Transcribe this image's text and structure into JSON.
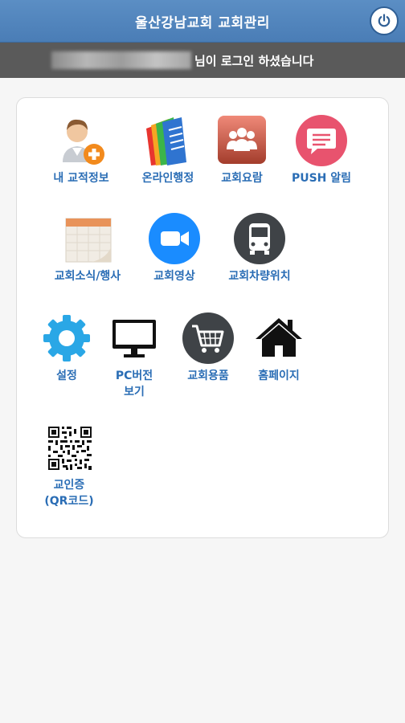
{
  "header": {
    "title": "울산강남교회 교회관리",
    "power_icon": "power-icon"
  },
  "login": {
    "suffix": "님이 로그인 하셨습니다"
  },
  "menu": {
    "items": [
      {
        "label": "내 교적정보",
        "icon": "add-user-icon"
      },
      {
        "label": "온라인행정",
        "icon": "documents-icon"
      },
      {
        "label": "교회요람",
        "icon": "people-group-icon"
      },
      {
        "label": "PUSH 알림",
        "icon": "message-icon"
      },
      {
        "label": "교회소식/행사",
        "icon": "calendar-icon"
      },
      {
        "label": "교회영상",
        "icon": "video-camera-icon"
      },
      {
        "label": "교회차량위치",
        "icon": "bus-icon"
      },
      {
        "label": "설정",
        "icon": "gear-icon"
      },
      {
        "label": "PC버전",
        "label2": "보기",
        "icon": "monitor-icon"
      },
      {
        "label": "교회용품",
        "icon": "shopping-cart-icon"
      },
      {
        "label": "홈페이지",
        "icon": "home-icon"
      },
      {
        "label": "교인증",
        "label2": "(QR코드)",
        "icon": "qr-code-icon"
      }
    ]
  },
  "colors": {
    "header": "#4a7db6",
    "login_bar": "#5a5a5a",
    "label": "#2a6db5",
    "background": "#f6f6f6"
  }
}
